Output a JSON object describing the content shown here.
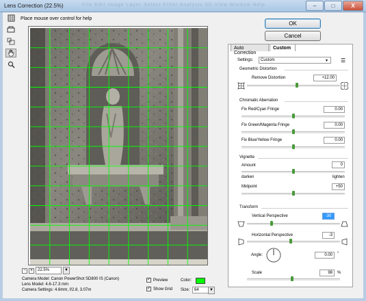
{
  "window": {
    "title": "Lens Correction (22.5%)",
    "menu_ghost": "File Edit Image Layer Select Filter Analysis 3D View Window Help",
    "minimize": "–",
    "maximize": "□",
    "close": "X"
  },
  "help_text": "Place mouse over control for help",
  "buttons": {
    "ok": "OK",
    "cancel": "Cancel"
  },
  "tabs": [
    "Auto Correction",
    "Custom"
  ],
  "settings": {
    "label": "Settings:",
    "value": "Custom",
    "menu_icon": "☰"
  },
  "geometric": {
    "title": "Geometric Distortion",
    "remove_label": "Remove Distortion",
    "remove_value": "+12.00",
    "slider_value": 12.0
  },
  "chromatic": {
    "title": "Chromatic Aberration",
    "red_label": "Fix Red/Cyan Fringe",
    "red_value": "0.00",
    "green_label": "Fix Green/Magenta Fringe",
    "green_value": "0.00",
    "blue_label": "Fix Blue/Yellow Fringe",
    "blue_value": "0.00"
  },
  "vignette": {
    "title": "Vignette",
    "amount_label": "Amount",
    "amount_value": "0",
    "darken": "darken",
    "lighten": "lighten",
    "midpoint_label": "Midpoint",
    "midpoint_value": "+50"
  },
  "transform": {
    "title": "Transform",
    "vertical_label": "Vertical Perspective",
    "vertical_value": "-30",
    "horizontal_label": "Horizontal Perspective",
    "horizontal_value": "-3",
    "angle_label": "Angle:",
    "angle_value": "0.00",
    "angle_unit": "°",
    "scale_label": "Scale",
    "scale_value": "98",
    "scale_unit": "%"
  },
  "zoom": {
    "minus": "−",
    "plus": "+",
    "value": "22.5%",
    "arrow": "▼"
  },
  "camera_info": {
    "model": "Camera Model: Canon PowerShot SD800 IS (Canon)",
    "lens": "Lens Model: 4.6-17.3 mm",
    "settings": "Camera Settings: 4.6mm, f/2.8, 3.07m"
  },
  "preview_options": {
    "preview_label": "Preview",
    "preview_checked": "✓",
    "show_grid_label": "Show Grid",
    "show_grid_checked": "✓",
    "color_label": "Color:",
    "grid_color": "#00ff00",
    "size_label": "Size:",
    "size_value": "64",
    "size_arrow": "▼"
  }
}
